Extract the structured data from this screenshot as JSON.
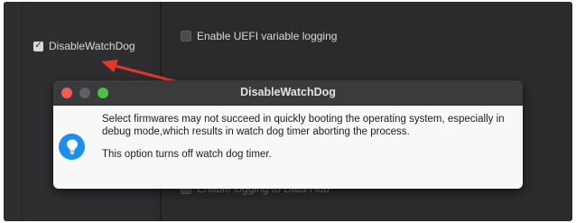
{
  "left_panel": {
    "watchdog_checkbox": {
      "label": "DisableWatchDog",
      "checked": true
    }
  },
  "right_panel": {
    "uefi_logging": {
      "label": "Enable UEFI variable logging",
      "checked": false
    },
    "data_hub_logging": {
      "label": "Enable logging to Data Hub",
      "checked": false
    }
  },
  "annotation": {
    "arrow_color": "#e0392b"
  },
  "popup": {
    "title": "DisableWatchDog",
    "message": "Select firmwares may not succeed in quickly booting the operating system, especially in debug  mode,which results in watch dog timer aborting the process.",
    "message2": "This option turns off watch dog timer.",
    "icon": "lightbulb-icon",
    "accent_color": "#1b8ef0"
  }
}
